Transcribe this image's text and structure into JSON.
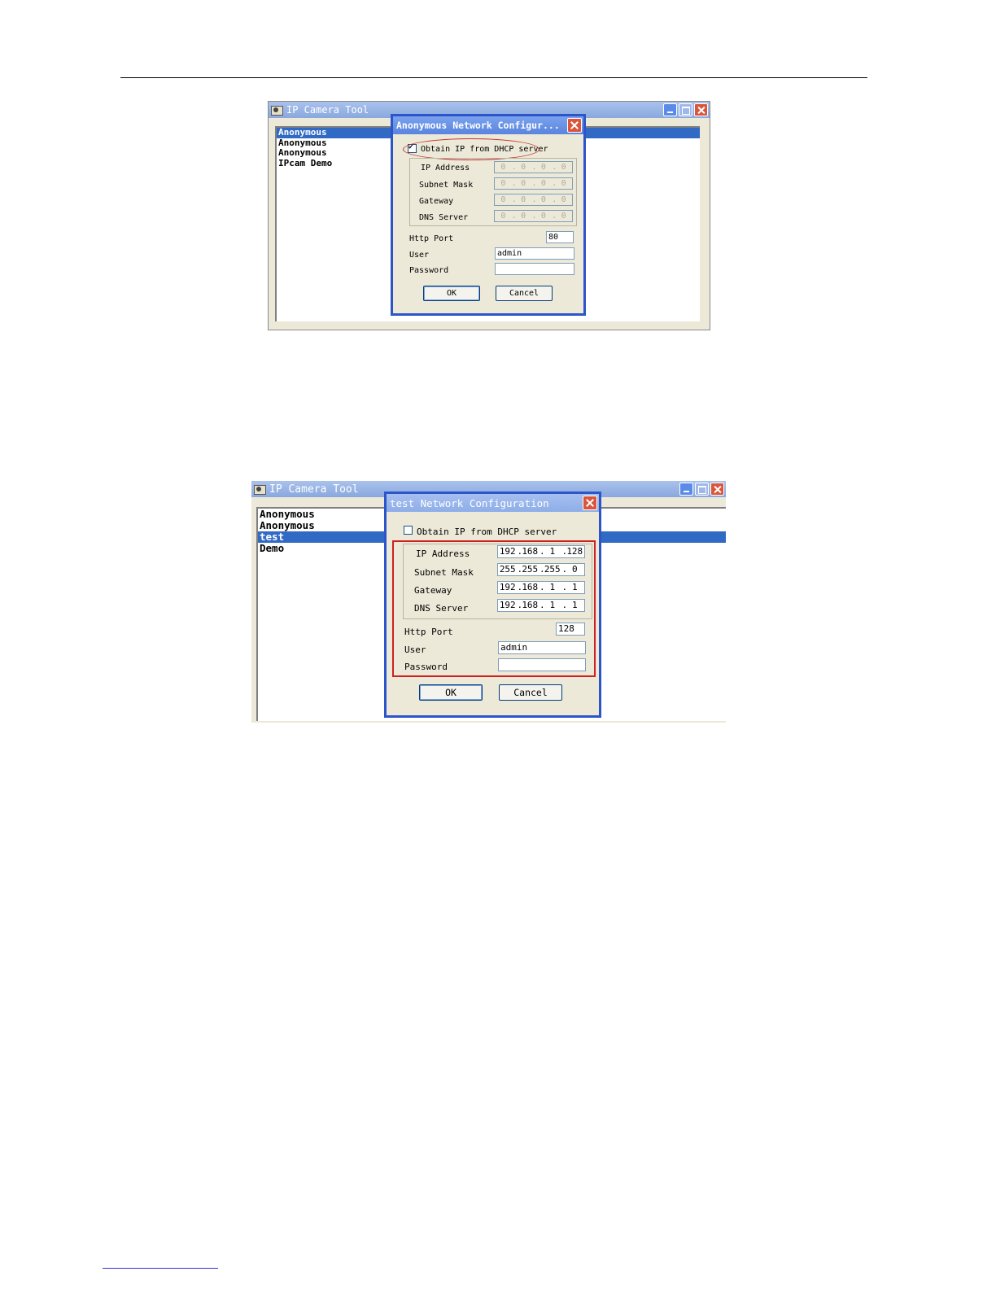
{
  "screenshots": [
    {
      "app_title": "IP Camera Tool",
      "devices": [
        "Anonymous",
        "Anonymous",
        "Anonymous",
        "IPcam Demo"
      ],
      "selected_index": 0,
      "dialog": {
        "title": "Anonymous Network Configur...",
        "dhcp_label": "Obtain IP from DHCP server",
        "dhcp_checked": true,
        "ip_label": "IP Address",
        "ip": [
          "0",
          "0",
          "0",
          "0"
        ],
        "mask_label": "Subnet Mask",
        "mask": [
          "0",
          "0",
          "0",
          "0"
        ],
        "gateway_label": "Gateway",
        "gateway": [
          "0",
          "0",
          "0",
          "0"
        ],
        "dns_label": "DNS Server",
        "dns": [
          "0",
          "0",
          "0",
          "0"
        ],
        "port_label": "Http Port",
        "port": "80",
        "user_label": "User",
        "user": "admin",
        "password_label": "Password",
        "password": "",
        "ok": "OK",
        "cancel": "Cancel"
      }
    },
    {
      "app_title": "IP Camera Tool",
      "devices": [
        "Anonymous",
        "Anonymous",
        "test",
        "Demo"
      ],
      "selected_index": 2,
      "dialog": {
        "title": "test Network Configuration",
        "dhcp_label": "Obtain IP from DHCP server",
        "dhcp_checked": false,
        "ip_label": "IP Address",
        "ip": [
          "192",
          "168",
          "1",
          "128"
        ],
        "mask_label": "Subnet Mask",
        "mask": [
          "255",
          "255",
          "255",
          "0"
        ],
        "gateway_label": "Gateway",
        "gateway": [
          "192",
          "168",
          "1",
          "1"
        ],
        "dns_label": "DNS Server",
        "dns": [
          "192",
          "168",
          "1",
          "1"
        ],
        "port_label": "Http Port",
        "port": "128",
        "user_label": "User",
        "user": "admin",
        "password_label": "Password",
        "password": "",
        "ok": "OK",
        "cancel": "Cancel"
      }
    }
  ]
}
